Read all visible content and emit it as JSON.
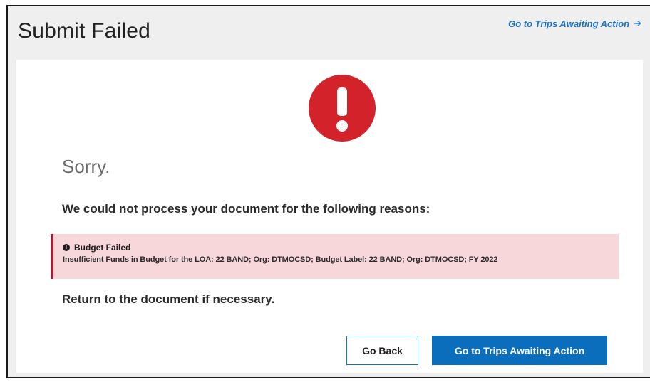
{
  "header": {
    "title": "Submit Failed",
    "link_label": "Go to Trips Awaiting Action",
    "link_arrow": "➔"
  },
  "error_icon": {
    "name": "exclamation-circle-icon",
    "color": "#d4222a"
  },
  "message": {
    "sorry": "Sorry.",
    "intro": "We could not process your document for the following reasons:",
    "return_hint": "Return to the document if necessary."
  },
  "alert": {
    "icon": "exclamation-icon",
    "title": "Budget Failed",
    "text": "Insufficient Funds in Budget for the LOA: 22 BAND; Org: DTMOCSD; Budget Label: 22 BAND; Org: DTMOCSD; FY 2022",
    "background": "#f8d7da",
    "border_color": "#a31f2b"
  },
  "buttons": {
    "back_label": "Go Back",
    "primary_label": "Go to Trips Awaiting Action",
    "primary_color": "#0a6ebd"
  }
}
